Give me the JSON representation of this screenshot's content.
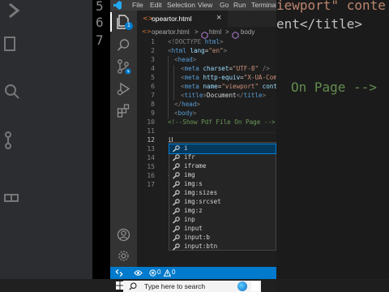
{
  "background": {
    "left_numbers": [
      "5",
      "6",
      "7"
    ],
    "right_text": [
      "iewport\" conte",
      "ent</title>",
      "On Page -->"
    ]
  },
  "menubar": {
    "items": [
      "File",
      "Edit",
      "Selection",
      "View",
      "Go",
      "Run",
      "Terminal"
    ]
  },
  "activity": {
    "explorer_badge": "1"
  },
  "tab": {
    "filename": "opeartor.html",
    "close": "×"
  },
  "breadcrumb": {
    "file": "opeartor.html",
    "sep1": ">",
    "html": "html",
    "sep2": ">",
    "body": "body"
  },
  "editor": {
    "line_numbers": [
      "1",
      "2",
      "3",
      "4",
      "5",
      "6",
      "7",
      "8",
      "9",
      "10",
      "11",
      "12",
      "13",
      "14",
      "15",
      "16",
      "17"
    ],
    "lines": {
      "l1": [
        "<!DOCTYPE ",
        "html",
        ">"
      ],
      "l2": [
        "<",
        "html",
        " ",
        "lang",
        "=",
        "\"en\"",
        ">"
      ],
      "l3": [
        "<",
        "head",
        ">"
      ],
      "l4": [
        "<",
        "meta",
        " ",
        "charset",
        "=",
        "\"UTF-8\"",
        " />"
      ],
      "l5": [
        "<",
        "meta",
        " ",
        "http-equiv",
        "=",
        "\"X-UA-Comp"
      ],
      "l6": [
        "<",
        "meta",
        " ",
        "name",
        "=",
        "\"viewport\"",
        " conte"
      ],
      "l7": [
        "<",
        "title",
        ">",
        "Document",
        "</",
        "title",
        ">"
      ],
      "l8": [
        "</",
        "head",
        ">"
      ],
      "l9": [
        "<",
        "body",
        ">"
      ],
      "l10": [
        "<!--Show Pdf File On Page -->"
      ],
      "l12": [
        "i"
      ],
      "l16": [
        "</"
      ]
    }
  },
  "suggest": {
    "items": [
      "i",
      "ifr",
      "iframe",
      "img",
      "img:s",
      "img:sizes",
      "img:srcset",
      "img:z",
      "inp",
      "input",
      "input:b",
      "input:btn"
    ]
  },
  "statusbar": {
    "errors": "0",
    "warnings": "0"
  },
  "taskbar": {
    "search_placeholder": "Type here to search"
  },
  "colors": {
    "tag": "#569cd6",
    "attr": "#9cdcfe",
    "string": "#ce9178",
    "comment": "#6a9955",
    "bracket": "#808080",
    "text": "#d4d4d4",
    "accent": "#007acc"
  }
}
